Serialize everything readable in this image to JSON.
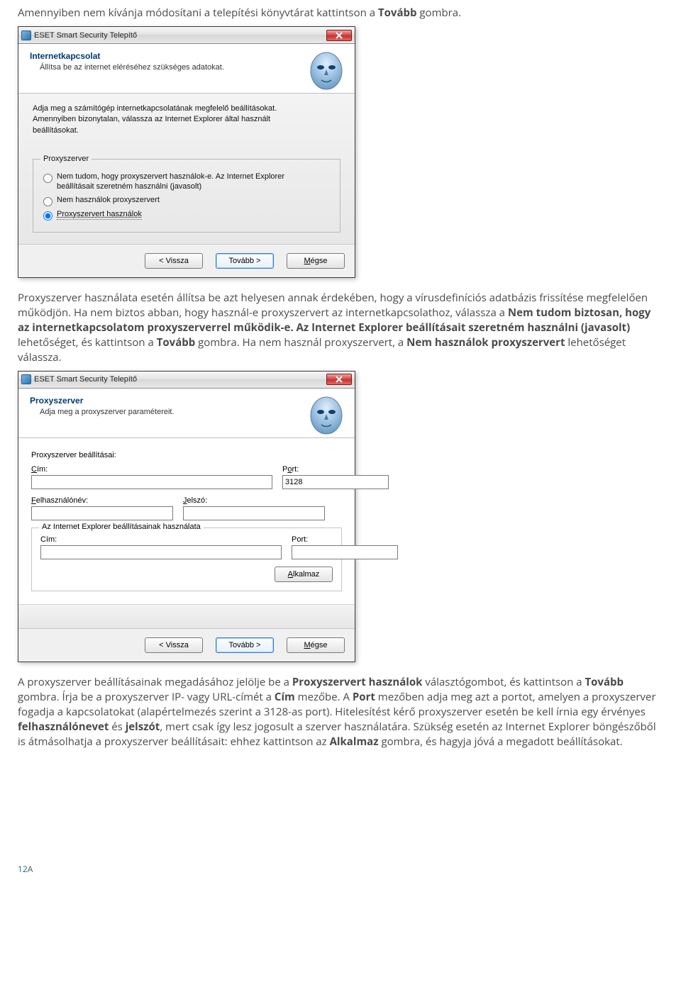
{
  "para1_a": "Amennyiben nem kívánja módosítani a telepítési könyvtárat kattintson a ",
  "para1_b": "Tovább",
  "para1_c": " gombra.",
  "dialog1": {
    "title": "ESET Smart Security Telepítő",
    "h_title": "Internetkapcsolat",
    "h_sub": "Állítsa be az internet eléréséhez szükséges adatokat.",
    "hint": "Adja meg a számítógép internetkapcsolatának megfelelő beállításokat. Amennyiben bizonytalan, válassza az Internet Explorer által használt beállításokat.",
    "legend": "Proxyszerver",
    "opt1": "Nem tudom, hogy proxyszervert használok-e. Az Internet Explorer beállításait szeretném használni (javasolt)",
    "opt2": "Nem használok proxyszervert",
    "opt3": "Proxyszervert használok",
    "back": "< Vissza",
    "next": "Tovább >",
    "cancel": "Mégse"
  },
  "para2_a": "Proxyszerver használata esetén állítsa be azt helyesen annak érdekében, hogy a vírusdefiníciós adatbázis frissítése megfelelően működjön. Ha nem biztos abban, hogy használ-e proxyszervert az internetkapcsolathoz, válassza a ",
  "para2_b": "Nem tudom biztosan, hogy az internetkapcsolatom proxyszerverrel működik-e. Az Internet Explorer beállításait szeretném használni (javasolt)",
  "para2_c": " lehetőséget, és kattintson a ",
  "para2_d": "Tovább",
  "para2_e": " gombra. Ha nem használ proxyszervert, a ",
  "para2_f": "Nem használok proxyszervert",
  "para2_g": " lehetőséget válassza.",
  "dialog2": {
    "title": "ESET Smart Security Telepítő",
    "h_title": "Proxyszerver",
    "h_sub": "Adja meg a proxyszerver paramétereit.",
    "section": "Proxyszerver beállításai:",
    "addr_label": "Cím:",
    "port_label": "Port:",
    "port_value": "3128",
    "user_label": "Felhasználónév:",
    "pass_label": "Jelszó:",
    "ie_legend": "Az Internet Explorer beállításainak használata",
    "ie_addr_label": "Cím:",
    "ie_port_label": "Port:",
    "apply": "Alkalmaz",
    "back": "< Vissza",
    "next": "Tovább >",
    "cancel": "Mégse"
  },
  "para3_a": "A proxyszerver beállításainak megadásához jelölje be a ",
  "para3_b": "Proxyszervert használok",
  "para3_c": " választógombot, és kattintson a ",
  "para3_d": "Tovább",
  "para3_e": " gombra. Írja be a proxyszerver IP- vagy URL-címét a ",
  "para3_f": "Cím",
  "para3_g": " mezőbe. A ",
  "para3_h": "Port",
  "para3_i": " mezőben adja meg azt a portot, amelyen a proxyszerver fogadja a kapcsolatokat (alapértelmezés szerint a 3128-as port). Hitelesítést kérő proxyszerver esetén be kell írnia egy érvényes ",
  "para3_j": "felhasználónevet",
  "para3_k": " és ",
  "para3_l": "jelszót",
  "para3_m": ", mert csak így lesz jogosult a szerver használatára. Szükség esetén az Internet Explorer böngészőből is átmásolhatja a proxyszerver beállításait: ehhez kattintson az ",
  "para3_n": "Alkalmaz",
  "para3_o": " gombra, és hagyja jóvá a megadott beállításokat.",
  "page_number": "12"
}
